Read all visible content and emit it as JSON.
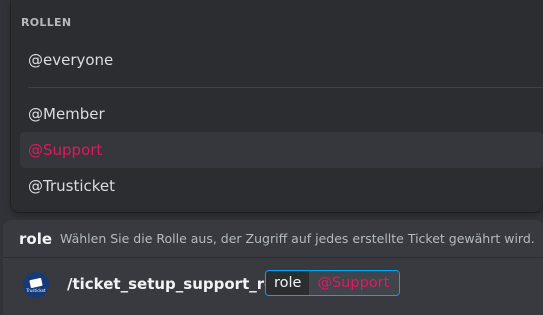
{
  "popup": {
    "header": "ROLLEN",
    "roles": [
      {
        "label": "@everyone"
      },
      {
        "label": "@Member"
      },
      {
        "label": "@Support",
        "color": "#e5175f",
        "highlighted": true
      },
      {
        "label": "@Trusticket"
      }
    ]
  },
  "option_hint": {
    "name": "role",
    "description": "Wählen Sie die Rolle aus, der Zugriff auf jedes erstellte Ticket gewährt wird."
  },
  "command": {
    "app_icon": "trusticket-app-icon",
    "app_icon_text": "Trusticket",
    "name": "/ticket_setup_support_role",
    "param_label": "role",
    "param_value": "@Support",
    "param_value_color": "#e5175f",
    "focus_border_color": "#00a8fc"
  }
}
